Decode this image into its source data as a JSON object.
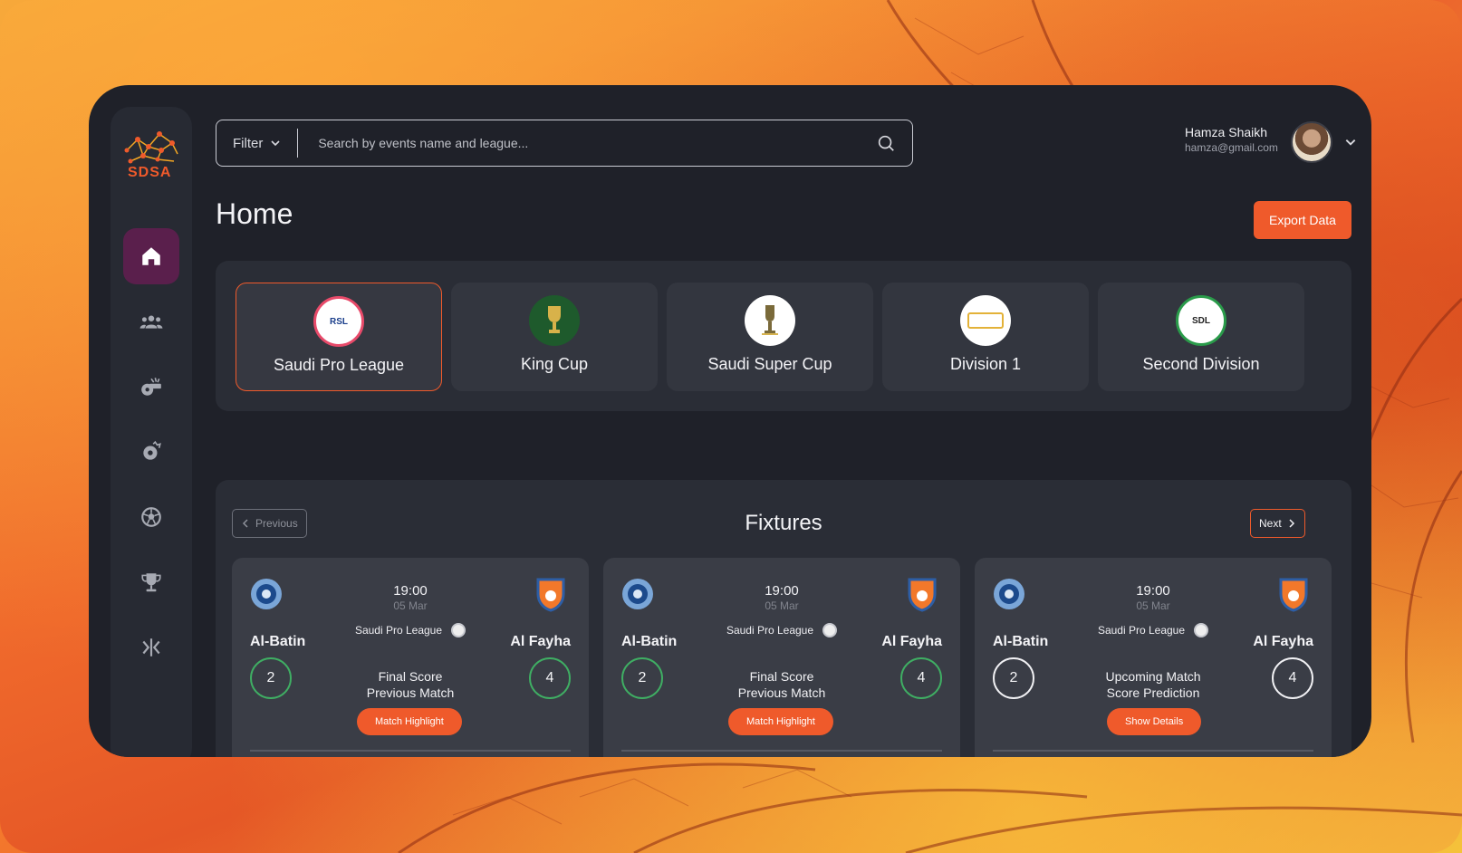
{
  "brand": {
    "logo_text": "SDSA",
    "accent": "#ef5a2b"
  },
  "sidebar": {
    "items": [
      {
        "icon": "home-icon",
        "active": true
      },
      {
        "icon": "users-icon",
        "active": false
      },
      {
        "icon": "whistle-icon",
        "active": false
      },
      {
        "icon": "football-cloud-icon",
        "active": false
      },
      {
        "icon": "football-icon",
        "active": false
      },
      {
        "icon": "trophy-icon",
        "active": false
      },
      {
        "icon": "collapse-icon",
        "active": false
      }
    ]
  },
  "header": {
    "filter_label": "Filter",
    "search_placeholder": "Search by events name and league...",
    "user_name": "Hamza Shaikh",
    "user_email": "hamza@gmail.com"
  },
  "page": {
    "title": "Home",
    "export_label": "Export Data"
  },
  "leagues": [
    {
      "name": "Saudi Pro League",
      "logo_text": "RSL",
      "selected": true
    },
    {
      "name": "King Cup",
      "logo_text": "",
      "selected": false
    },
    {
      "name": "Saudi Super Cup",
      "logo_text": "",
      "selected": false
    },
    {
      "name": "Division 1",
      "logo_text": "",
      "selected": false
    },
    {
      "name": "Second Division",
      "logo_text": "SDL",
      "selected": false
    }
  ],
  "fixtures": {
    "title": "Fixtures",
    "prev_label": "Previous",
    "next_label": "Next",
    "matches": [
      {
        "home": "Al-Batin",
        "away": "Al Fayha",
        "time": "19:00",
        "date": "05 Mar",
        "league": "Saudi Pro League",
        "home_score": "2",
        "away_score": "4",
        "status_line1": "Final Score",
        "status_line2": "Previous Match",
        "action": "Match Highlight",
        "style": "green"
      },
      {
        "home": "Al-Batin",
        "away": "Al Fayha",
        "time": "19:00",
        "date": "05 Mar",
        "league": "Saudi Pro League",
        "home_score": "2",
        "away_score": "4",
        "status_line1": "Final Score",
        "status_line2": "Previous Match",
        "action": "Match Highlight",
        "style": "green"
      },
      {
        "home": "Al-Batin",
        "away": "Al Fayha",
        "time": "19:00",
        "date": "05 Mar",
        "league": "Saudi Pro League",
        "home_score": "2",
        "away_score": "4",
        "status_line1": "Upcoming Match",
        "status_line2": "Score Prediction",
        "action": "Show Details",
        "style": "white"
      }
    ]
  }
}
